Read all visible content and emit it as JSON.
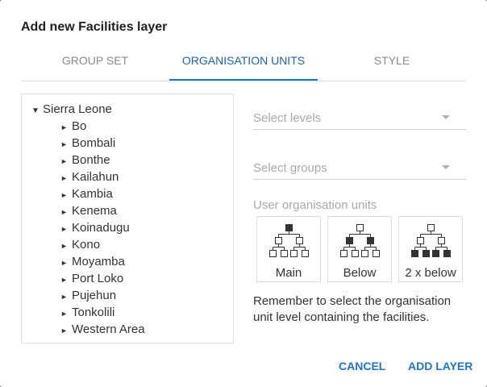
{
  "dialog": {
    "title": "Add new Facilities layer"
  },
  "tabs": [
    {
      "label": "GROUP SET",
      "active": false
    },
    {
      "label": "ORGANISATION UNITS",
      "active": true
    },
    {
      "label": "STYLE",
      "active": false
    }
  ],
  "tree": {
    "root": "Sierra Leone",
    "children": [
      "Bo",
      "Bombali",
      "Bonthe",
      "Kailahun",
      "Kambia",
      "Kenema",
      "Koinadugu",
      "Kono",
      "Moyamba",
      "Port Loko",
      "Pujehun",
      "Tonkolili",
      "Western Area"
    ]
  },
  "levels_select": {
    "placeholder": "Select levels"
  },
  "groups_select": {
    "placeholder": "Select groups"
  },
  "user_ou": {
    "label": "User organisation units",
    "buttons": [
      {
        "label": "Main",
        "icon": "org-tree-main-icon"
      },
      {
        "label": "Below",
        "icon": "org-tree-below-icon"
      },
      {
        "label": "2 x below",
        "icon": "org-tree-two-below-icon"
      }
    ]
  },
  "note": "Remember to select the organisation unit level containing the facilities.",
  "actions": {
    "cancel": "CANCEL",
    "add": "ADD LAYER"
  },
  "colors": {
    "accent": "#1976d2",
    "text": "#333333",
    "muted": "#aaaaaa"
  }
}
